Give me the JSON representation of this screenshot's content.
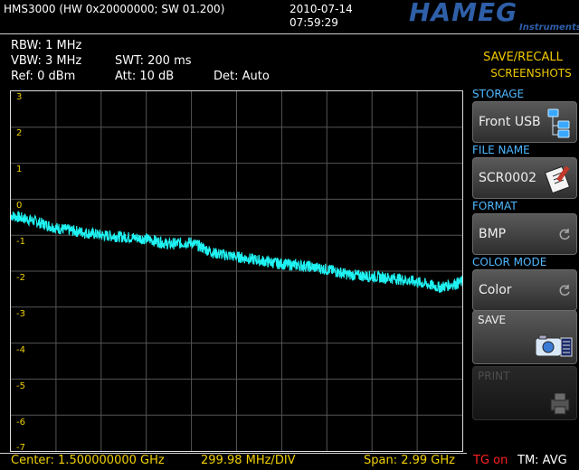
{
  "header": {
    "device_info": "HMS3000 (HW 0x20000000; SW 01.200)",
    "date": "2010-07-14",
    "time": "07:59:29",
    "logo_text": "HAMEG",
    "logo_subtext": "Instruments"
  },
  "params": {
    "rbw": "RBW: 1 MHz",
    "vbw": "VBW: 3 MHz",
    "swt": "SWT: 200 ms",
    "ref": "Ref: 0 dBm",
    "att": "Att: 10 dB",
    "det": "Det: Auto"
  },
  "menu": {
    "title_line1": "SAVE/RECALL",
    "title_line2": "SCREENSHOTS",
    "storage_label": "STORAGE",
    "storage_value": "Front USB",
    "file_name_label": "FILE NAME",
    "file_name_value": "SCR0002",
    "format_label": "FORMAT",
    "format_value": "BMP",
    "color_mode_label": "COLOR MODE",
    "color_mode_value": "Color",
    "save_label": "SAVE",
    "print_label": "PRINT"
  },
  "footer": {
    "center": "Center: 1.500000000 GHz",
    "div": "299.98 MHz/DIV",
    "span": "Span: 2.99 GHz",
    "tg": "TG on",
    "tm": "TM: AVG"
  },
  "colors": {
    "trace": "#1ff2f2",
    "label_yellow": "#f0d000",
    "section_blue": "#4fb8ff",
    "tg_red": "#ff2020"
  },
  "chart_data": {
    "type": "line",
    "title": "",
    "xlabel": "",
    "ylabel": "",
    "ylim": [
      -7,
      3
    ],
    "y_ticks": [
      "3",
      "2",
      "1",
      "0",
      "-1",
      "-2",
      "-3",
      "-4",
      "-5",
      "-6",
      "-7"
    ],
    "x_divisions": 10,
    "grid": true,
    "series": [
      {
        "x": [
          0,
          0.5,
          1,
          1.5,
          2,
          2.5,
          3,
          3.5,
          4,
          4.5,
          5,
          5.5,
          6,
          6.5,
          7,
          7.5,
          8,
          8.5,
          9,
          9.5,
          10
        ],
        "values": [
          -0.45,
          -0.6,
          -0.8,
          -0.9,
          -1.0,
          -1.05,
          -1.1,
          -1.25,
          -1.2,
          -1.5,
          -1.6,
          -1.7,
          -1.8,
          -1.85,
          -1.95,
          -2.1,
          -2.15,
          -2.2,
          -2.3,
          -2.45,
          -2.3
        ]
      }
    ]
  }
}
